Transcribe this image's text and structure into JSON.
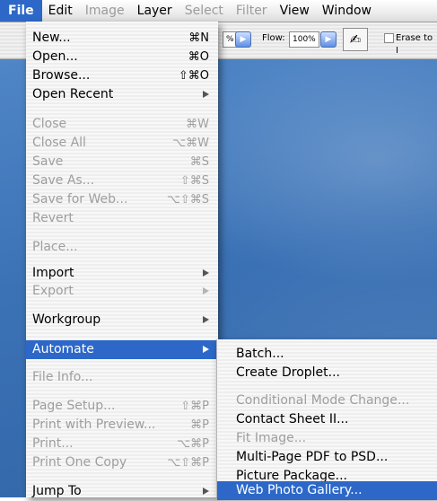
{
  "menubar": {
    "items": [
      {
        "label": "File",
        "state": "selected"
      },
      {
        "label": "Edit",
        "state": "enabled"
      },
      {
        "label": "Image",
        "state": "disabled"
      },
      {
        "label": "Layer",
        "state": "enabled"
      },
      {
        "label": "Select",
        "state": "disabled"
      },
      {
        "label": "Filter",
        "state": "disabled"
      },
      {
        "label": "View",
        "state": "enabled"
      },
      {
        "label": "Window",
        "state": "enabled"
      }
    ]
  },
  "toolbar": {
    "opacity_partial": "%",
    "flow_label": "Flow:",
    "flow_value": "100%",
    "brush_icon": "airbrush-icon",
    "erase_label": "Erase to I"
  },
  "file_menu": {
    "items": [
      {
        "label": "New...",
        "shortcut": "⌘N",
        "disabled": false
      },
      {
        "label": "Open...",
        "shortcut": "⌘O",
        "disabled": false
      },
      {
        "label": "Browse...",
        "shortcut": "⇧⌘O",
        "disabled": false
      },
      {
        "label": "Open Recent",
        "shortcut": "",
        "submenu": true,
        "disabled": false
      },
      {
        "label": "Close",
        "shortcut": "⌘W",
        "disabled": true
      },
      {
        "label": "Close All",
        "shortcut": "⌥⌘W",
        "disabled": true
      },
      {
        "label": "Save",
        "shortcut": "⌘S",
        "disabled": true
      },
      {
        "label": "Save As...",
        "shortcut": "⇧⌘S",
        "disabled": true
      },
      {
        "label": "Save for Web...",
        "shortcut": "⌥⇧⌘S",
        "disabled": true
      },
      {
        "label": "Revert",
        "shortcut": "",
        "disabled": true
      },
      {
        "label": "Place...",
        "shortcut": "",
        "disabled": true
      },
      {
        "label": "Import",
        "shortcut": "",
        "submenu": true,
        "disabled": false
      },
      {
        "label": "Export",
        "shortcut": "",
        "submenu": true,
        "disabled": true
      },
      {
        "label": "Workgroup",
        "shortcut": "",
        "submenu": true,
        "disabled": false
      },
      {
        "label": "Automate",
        "shortcut": "",
        "submenu": true,
        "disabled": false,
        "highlighted": true
      },
      {
        "label": "File Info...",
        "shortcut": "",
        "disabled": true
      },
      {
        "label": "Page Setup...",
        "shortcut": "⇧⌘P",
        "disabled": true
      },
      {
        "label": "Print with Preview...",
        "shortcut": "⌘P",
        "disabled": true
      },
      {
        "label": "Print...",
        "shortcut": "⌥⌘P",
        "disabled": true
      },
      {
        "label": "Print One Copy",
        "shortcut": "⌥⇧⌘P",
        "disabled": true
      },
      {
        "label": "Jump To",
        "shortcut": "",
        "submenu": true,
        "disabled": false
      }
    ]
  },
  "automate_menu": {
    "items": [
      {
        "label": "Batch...",
        "disabled": false
      },
      {
        "label": "Create Droplet...",
        "disabled": false
      },
      {
        "label": "Conditional Mode Change...",
        "disabled": true
      },
      {
        "label": "Contact Sheet II...",
        "disabled": false
      },
      {
        "label": "Fit Image...",
        "disabled": true
      },
      {
        "label": "Multi-Page PDF to PSD...",
        "disabled": false
      },
      {
        "label": "Picture Package...",
        "disabled": false
      },
      {
        "label": "Web Photo Gallery...",
        "disabled": false,
        "highlighted": true
      }
    ]
  },
  "colors": {
    "menu_highlight": "#2d68c8",
    "disabled_text": "#9e9e9e",
    "desktop_blue": "#3b72b6"
  }
}
